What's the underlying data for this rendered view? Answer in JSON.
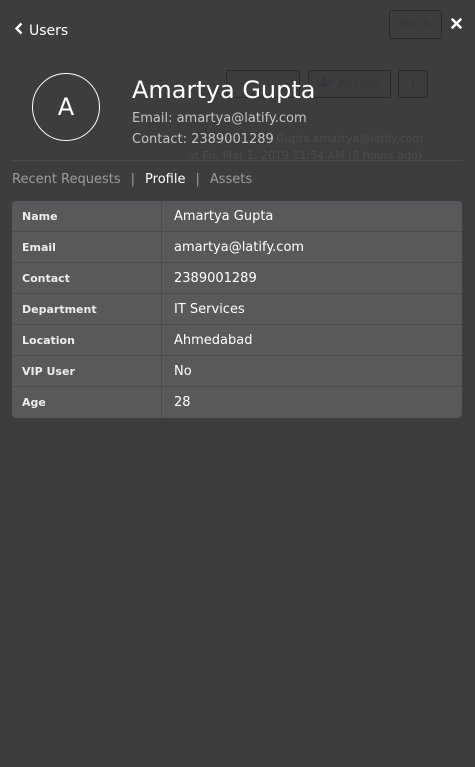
{
  "header": {
    "back_label": "Users",
    "back_icon": "chevron-left-icon",
    "close_icon": "close-icon"
  },
  "background": {
    "back_button": "Back",
    "assign_button": "Assign",
    "status_text_1": "Gupta  amartya@latify.com",
    "status_text_2": "at Fri, Mar 1, 2019 11:54 AM (8 hours ago)"
  },
  "user": {
    "avatar_initial": "A",
    "name": "Amartya Gupta",
    "email_line": "Email: amartya@latify.com",
    "contact_line": "Contact: 2389001289"
  },
  "tabs": [
    {
      "label": "Recent Requests",
      "active": false
    },
    {
      "label": "Profile",
      "active": true
    },
    {
      "label": "Assets",
      "active": false
    }
  ],
  "tab_separator": "|",
  "profile": [
    {
      "label": "Name",
      "value": "Amartya Gupta"
    },
    {
      "label": "Email",
      "value": "amartya@latify.com"
    },
    {
      "label": "Contact",
      "value": "2389001289"
    },
    {
      "label": "Department",
      "value": "IT Services"
    },
    {
      "label": "Location",
      "value": "Ahmedabad"
    },
    {
      "label": "VIP User",
      "value": "No"
    },
    {
      "label": "Age",
      "value": "28"
    }
  ],
  "colors": {
    "overlay_bg": "#3d3d3e",
    "table_bg": "#58595a",
    "muted_text": "#9b9c9e"
  }
}
